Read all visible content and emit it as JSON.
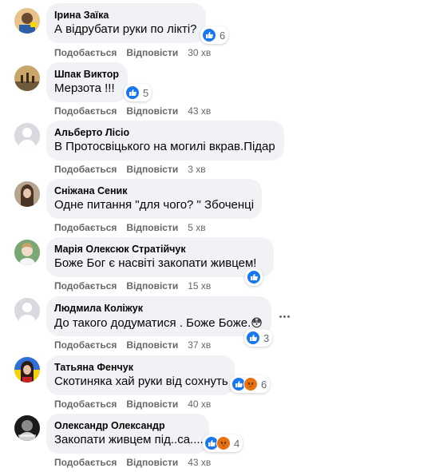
{
  "actions": {
    "like": "Подобається",
    "reply": "Відповісти"
  },
  "colors": {
    "like_blue": "#1877f2",
    "angry_orange": "#e9710f",
    "bubble": "#f0f2f5",
    "muted": "#65676b"
  },
  "comments": [
    {
      "author": "Ірина Заїка",
      "text": "А відрубати руки по лікті?",
      "time": "30 хв",
      "reactions": [
        "like-icon"
      ],
      "count": "6"
    },
    {
      "author": "Шпак Виктор",
      "text": "Мерзота !!!",
      "time": "43 хв",
      "reactions": [
        "like-icon"
      ],
      "count": "5"
    },
    {
      "author": "Альберто Лісіо",
      "text": "В Протосвіцького на могилі вкрав.Підар",
      "time": "3 хв",
      "reactions": [],
      "count": ""
    },
    {
      "author": "Сніжана Сеник",
      "text": "Одне питання \"для чого? \" Збоченці",
      "time": "5 хв",
      "reactions": [],
      "count": ""
    },
    {
      "author": "Марія Олексюк Стратійчук",
      "text": "Боже Бог є насвіті закопати живцем!",
      "time": "15 хв",
      "reactions": [
        "like-icon"
      ],
      "count": ""
    },
    {
      "author": "Людмила Коліжук",
      "text": "До такого додуматися . Боже Боже.",
      "emoji": "😳",
      "time": "37 хв",
      "reactions": [
        "like-icon"
      ],
      "count": "3"
    },
    {
      "author": "Татьяна Фенчук",
      "text": "Скотиняка хай руки від сохнуть",
      "time": "40 хв",
      "reactions": [
        "like-icon",
        "angry-icon"
      ],
      "count": "6"
    },
    {
      "author": "Олександр Олександр",
      "text": "Закопати живцем під..са....",
      "time": "43 хв",
      "reactions": [
        "like-icon",
        "angry-icon"
      ],
      "count": "4"
    }
  ]
}
